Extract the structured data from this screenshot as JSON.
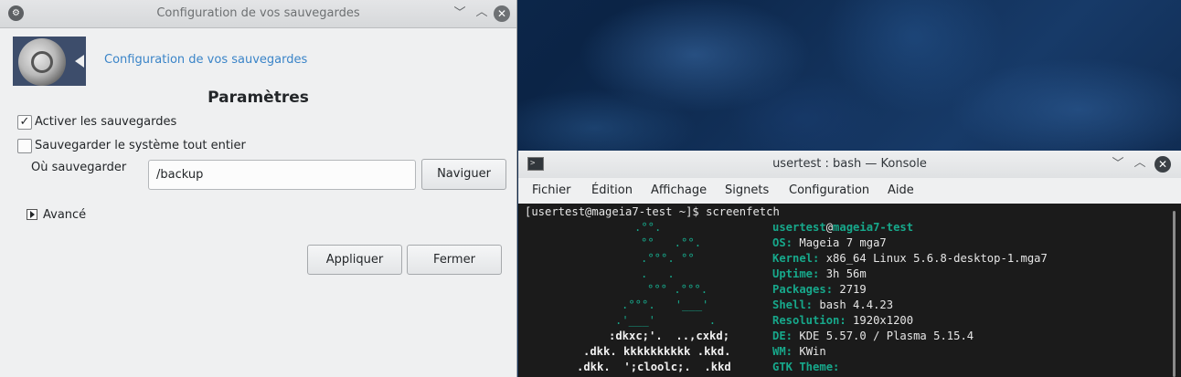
{
  "backup_window": {
    "title": "Configuration de vos sauvegardes",
    "header_link": "Configuration de vos sauvegardes",
    "section_title": "Paramètres",
    "enable_backups": {
      "label": "Activer les sauvegardes",
      "checked": true
    },
    "backup_whole_system": {
      "label": "Sauvegarder le système tout entier",
      "checked": false
    },
    "where_label": "Où sauvegarder",
    "path_value": "/backup",
    "browse_label": "Naviguer",
    "advanced_label": "Avancé",
    "apply_label": "Appliquer",
    "close_label": "Fermer"
  },
  "konsole": {
    "title": "usertest : bash — Konsole",
    "menu": [
      "Fichier",
      "Édition",
      "Affichage",
      "Signets",
      "Configuration",
      "Aide"
    ],
    "prompt": "[usertest@mageia7-test ~]$ screenfetch",
    "user": "usertest",
    "at": "@",
    "host": "mageia7-test",
    "info": [
      {
        "key": "OS:",
        "value": " Mageia 7 mga7"
      },
      {
        "key": "Kernel:",
        "value": " x86_64 Linux 5.6.8-desktop-1.mga7"
      },
      {
        "key": "Uptime:",
        "value": " 3h 56m"
      },
      {
        "key": "Packages:",
        "value": " 2719"
      },
      {
        "key": "Shell:",
        "value": " bash 4.4.23"
      },
      {
        "key": "Resolution:",
        "value": " 1920x1200"
      },
      {
        "key": "DE:",
        "value": " KDE 5.57.0 / Plasma 5.15.4"
      },
      {
        "key": "WM:",
        "value": " KWin"
      },
      {
        "key": "GTK Theme:",
        "value": ""
      }
    ],
    "ascii_art": [
      ".°°.",
      "°°   .°°.",
      ".°°°. °°",
      ".   .",
      "°°° .°°°.",
      ".°°°.   '___'",
      ".'___'        .",
      ":dkxc;'.  ..,cxkd;",
      ".dkk. kkkkkkkkkk .kkd.",
      ".dkk.  ';cloolc;.  .kkd"
    ]
  },
  "colors": {
    "accent_link": "#3a84c8",
    "terminal_info": "#17a88b",
    "terminal_bg": "#1b1b1b",
    "window_bg": "#eff0f1"
  }
}
